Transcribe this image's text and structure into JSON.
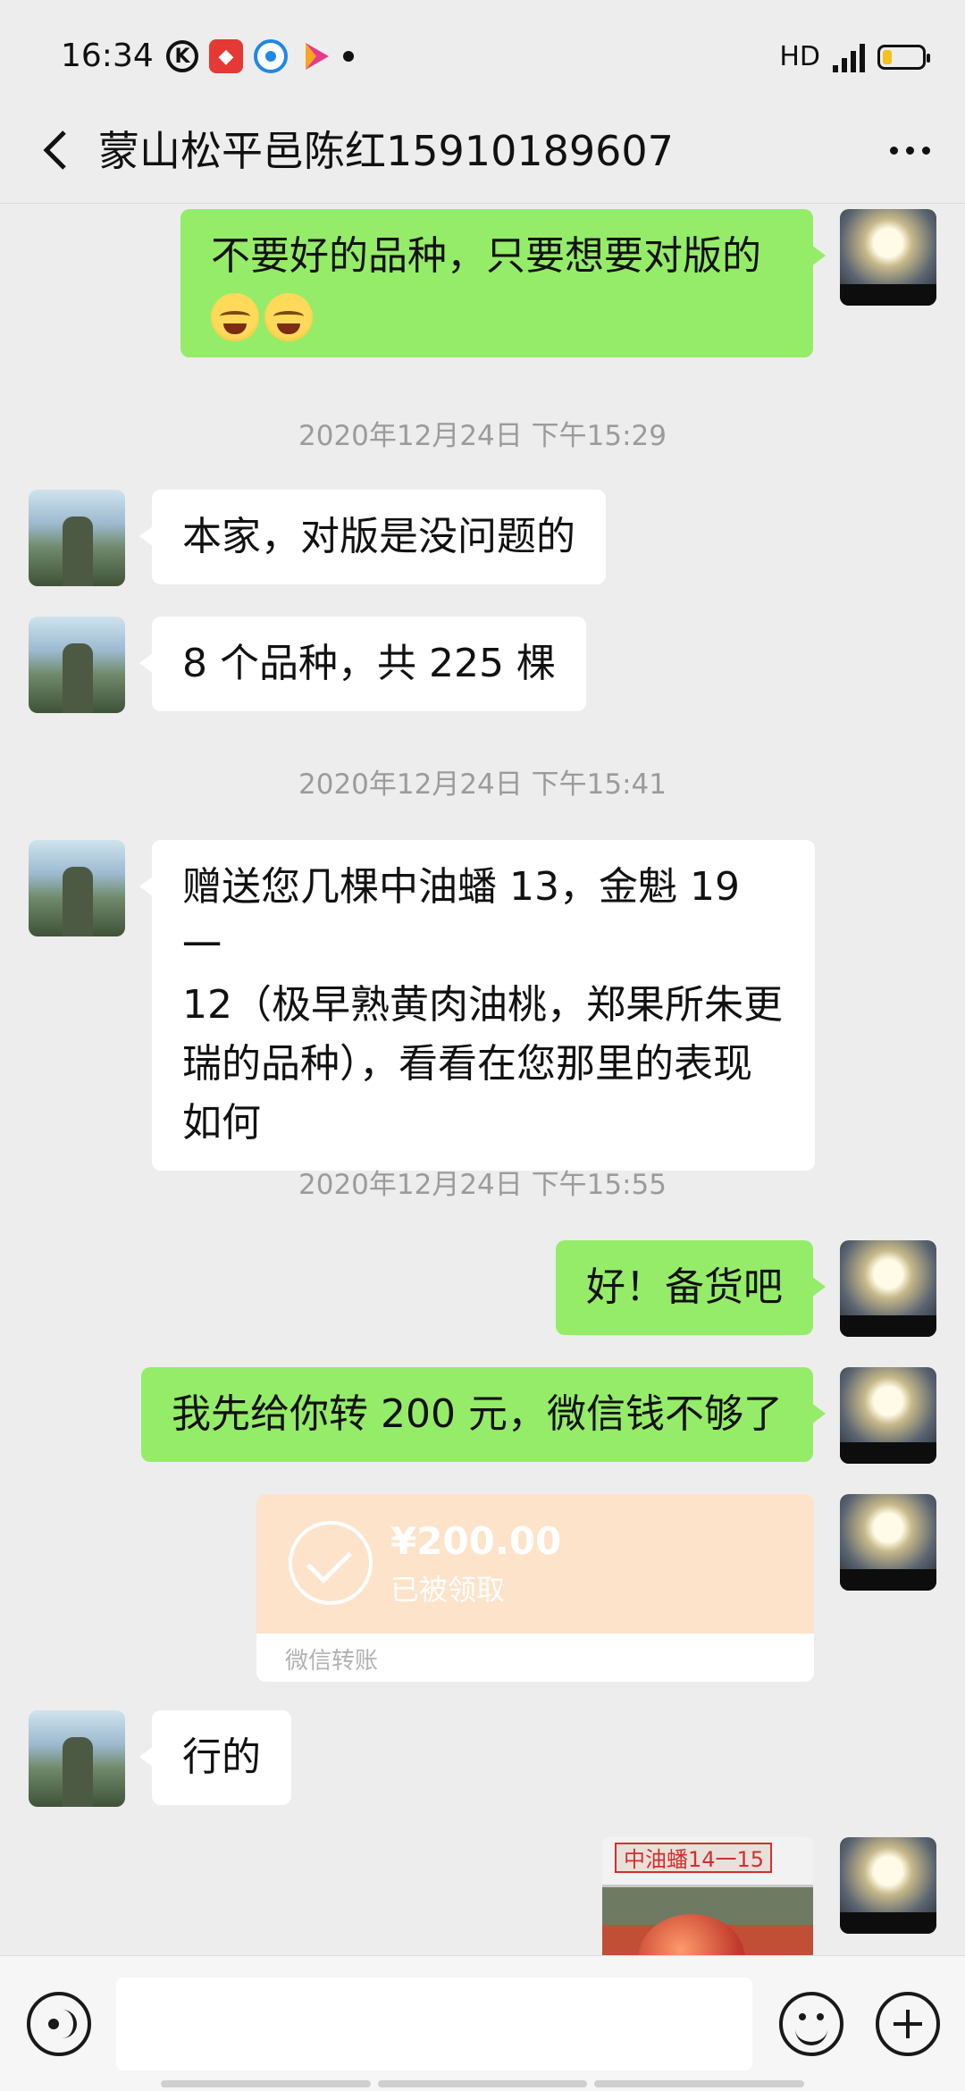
{
  "status_bar": {
    "time": "16:34",
    "network": "HD",
    "network_type": "4G"
  },
  "header": {
    "title": "蒙山松平邑陈红15910189607",
    "back_icon": "chevron-left-icon",
    "more_icon": "more-dots-icon"
  },
  "messages": {
    "m1": {
      "from": "me",
      "text": "不要好的品种，只要想要对版的",
      "emoji_count": 2
    },
    "t1": "2020年12月24日 下午15:29",
    "m2": {
      "from": "other",
      "text": "本家，对版是没问题的"
    },
    "m3": {
      "from": "other",
      "text": "8 个品种，共 225 棵"
    },
    "t2": "2020年12月24日 下午15:41",
    "m4": {
      "from": "other",
      "line1": "赠送您几棵中油蟠 13，金魁 19 一",
      "line2": "12（极早熟黄肉油桃，郑果所朱更",
      "line3": "瑞的品种），看看在您那里的表现",
      "line4": "如何"
    },
    "t3": "2020年12月24日 下午15:55",
    "m5": {
      "from": "me",
      "text": "好！备货吧"
    },
    "m6": {
      "from": "me",
      "text": "我先给你转 200 元，微信钱不够了"
    },
    "m7": {
      "from": "me",
      "type": "transfer",
      "amount": "¥200.00",
      "status": "已被领取",
      "label": "微信转账"
    },
    "m8": {
      "from": "other",
      "text": "行的"
    },
    "m9": {
      "from": "me",
      "type": "image",
      "caption": "中油蟠14一15"
    }
  },
  "input_bar": {
    "voice_icon": "voice-icon",
    "placeholder": "",
    "emoji_icon": "emoji-icon",
    "plus_icon": "plus-icon"
  },
  "colors": {
    "background": "#ededed",
    "my_bubble": "#95ec69",
    "other_bubble": "#ffffff",
    "transfer_card": "#fde3c9",
    "timestamp": "#9b9b9b"
  }
}
